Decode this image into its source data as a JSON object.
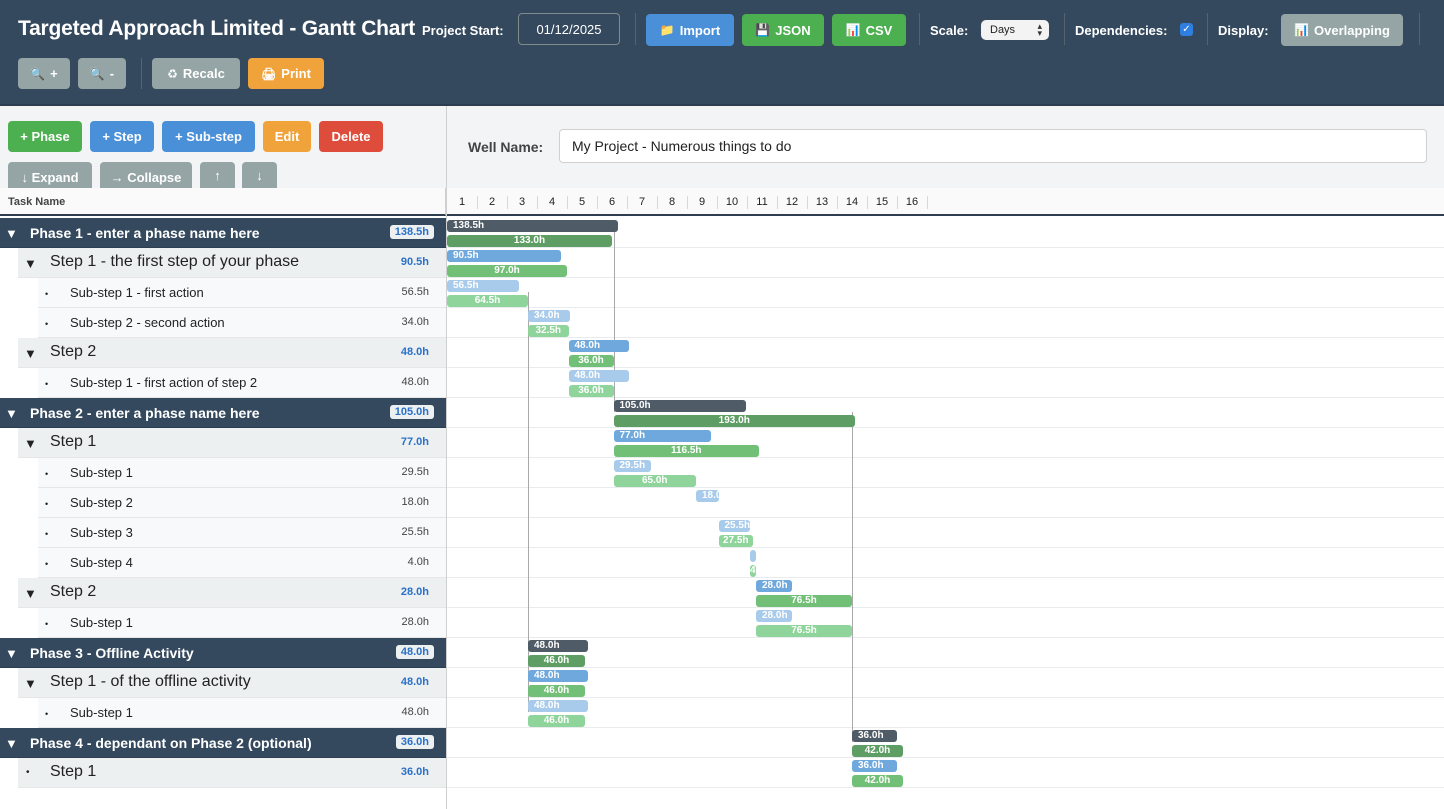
{
  "header": {
    "title": "Targeted Approach Limited - Gantt Chart",
    "project_start_label": "Project Start:",
    "project_start_value": "01/12/2025",
    "import_label": "Import",
    "json_label": "JSON",
    "csv_label": "CSV",
    "scale_label": "Scale:",
    "scale_value": "Days",
    "dependencies_label": "Dependencies:",
    "dependencies_checked": true,
    "display_label": "Display:",
    "display_value": "Overlapping",
    "zoom_in_label": "+",
    "zoom_out_label": "-",
    "recalc_label": "Recalc",
    "print_label": "Print"
  },
  "toolbar": {
    "add_phase": "+ Phase",
    "add_step": "+ Step",
    "add_substep": "+ Sub-step",
    "edit": "Edit",
    "delete": "Delete",
    "expand": "↓ Expand",
    "collapse": "→ Collapse",
    "move_up": "↑",
    "move_down": "↓"
  },
  "well": {
    "label": "Well Name:",
    "value": "My Project - Numerous things to do"
  },
  "task_header": "Task Name",
  "day_ticks": [
    "1",
    "2",
    "3",
    "4",
    "5",
    "6",
    "7",
    "8",
    "9",
    "10",
    "11",
    "12",
    "13",
    "14",
    "15",
    "16"
  ],
  "tasks": [
    {
      "level": "phase",
      "toggle": "▼",
      "name": "Phase 1 - enter a phase name here",
      "hours": "138.5h"
    },
    {
      "level": "step",
      "toggle": "▼",
      "name": "Step 1 - the first step of your phase",
      "hours": "90.5h"
    },
    {
      "level": "sub",
      "toggle": "•",
      "name": "Sub-step 1 - first action",
      "hours": "56.5h"
    },
    {
      "level": "sub",
      "toggle": "•",
      "name": "Sub-step 2 - second action",
      "hours": "34.0h"
    },
    {
      "level": "step",
      "toggle": "▼",
      "name": "Step 2",
      "hours": "48.0h"
    },
    {
      "level": "sub",
      "toggle": "•",
      "name": "Sub-step 1 - first action of step 2",
      "hours": "48.0h"
    },
    {
      "level": "phase",
      "toggle": "▼",
      "name": "Phase 2 - enter a phase name here",
      "hours": "105.0h"
    },
    {
      "level": "step",
      "toggle": "▼",
      "name": "Step 1",
      "hours": "77.0h"
    },
    {
      "level": "sub",
      "toggle": "•",
      "name": "Sub-step 1",
      "hours": "29.5h"
    },
    {
      "level": "sub",
      "toggle": "•",
      "name": "Sub-step 2",
      "hours": "18.0h"
    },
    {
      "level": "sub",
      "toggle": "•",
      "name": "Sub-step 3",
      "hours": "25.5h"
    },
    {
      "level": "sub",
      "toggle": "•",
      "name": "Sub-step 4",
      "hours": "4.0h"
    },
    {
      "level": "step",
      "toggle": "▼",
      "name": "Step 2",
      "hours": "28.0h"
    },
    {
      "level": "sub",
      "toggle": "•",
      "name": "Sub-step 1",
      "hours": "28.0h"
    },
    {
      "level": "phase",
      "toggle": "▼",
      "name": "Phase 3 - Offline Activity",
      "hours": "48.0h"
    },
    {
      "level": "step",
      "toggle": "▼",
      "name": "Step 1 - of the offline activity",
      "hours": "48.0h"
    },
    {
      "level": "sub",
      "toggle": "•",
      "name": "Sub-step 1",
      "hours": "48.0h"
    },
    {
      "level": "phase",
      "toggle": "▼",
      "name": "Phase 4 - dependant on Phase 2 (optional)",
      "hours": "36.0h"
    },
    {
      "level": "step",
      "toggle": "•",
      "name": "Step 1",
      "hours": "36.0h"
    }
  ],
  "bars": [
    {
      "row": 0,
      "planned": {
        "start": 1.0,
        "end": 6.7,
        "label": "138.5h"
      },
      "actual": {
        "start": 1.0,
        "end": 6.5,
        "label": "133.0h"
      }
    },
    {
      "row": 1,
      "planned": {
        "start": 1.0,
        "end": 4.8,
        "label": "90.5h"
      },
      "actual": {
        "start": 1.0,
        "end": 5.0,
        "label": "97.0h"
      }
    },
    {
      "row": 2,
      "planned": {
        "start": 1.0,
        "end": 3.4,
        "label": "56.5h"
      },
      "actual": {
        "start": 1.0,
        "end": 3.7,
        "label": "64.5h"
      }
    },
    {
      "row": 3,
      "planned": {
        "start": 3.7,
        "end": 5.1,
        "label": "34.0h"
      },
      "actual": {
        "start": 3.7,
        "end": 5.05,
        "label": "32.5h"
      }
    },
    {
      "row": 4,
      "planned": {
        "start": 5.05,
        "end": 7.05,
        "label": "48.0h"
      },
      "actual": {
        "start": 5.05,
        "end": 6.55,
        "label": "36.0h"
      }
    },
    {
      "row": 5,
      "planned": {
        "start": 5.05,
        "end": 7.05,
        "label": "48.0h"
      },
      "actual": {
        "start": 5.05,
        "end": 6.55,
        "label": "36.0h"
      }
    },
    {
      "row": 6,
      "planned": {
        "start": 6.55,
        "end": 10.95,
        "label": "105.0h"
      },
      "actual": {
        "start": 6.55,
        "end": 14.6,
        "label": "193.0h"
      }
    },
    {
      "row": 7,
      "planned": {
        "start": 6.55,
        "end": 9.8,
        "label": "77.0h"
      },
      "actual": {
        "start": 6.55,
        "end": 11.4,
        "label": "116.5h"
      }
    },
    {
      "row": 8,
      "planned": {
        "start": 6.55,
        "end": 7.8,
        "label": "29.5h"
      },
      "actual": {
        "start": 6.55,
        "end": 9.3,
        "label": "65.0h"
      }
    },
    {
      "row": 9,
      "planned": {
        "start": 9.3,
        "end": 10.05,
        "label": "18.0h"
      },
      "actual": null
    },
    {
      "row": 10,
      "planned": {
        "start": 10.05,
        "end": 11.1,
        "label": "25.5h"
      },
      "actual": {
        "start": 10.05,
        "end": 11.2,
        "label": "27.5h"
      }
    },
    {
      "row": 11,
      "planned": {
        "start": 11.1,
        "end": 11.3,
        "label": "4.0h"
      },
      "actual": {
        "start": 11.1,
        "end": 11.3,
        "label": "4.0h"
      }
    },
    {
      "row": 12,
      "planned": {
        "start": 11.3,
        "end": 12.5,
        "label": "28.0h"
      },
      "actual": {
        "start": 11.3,
        "end": 14.5,
        "label": "76.5h"
      }
    },
    {
      "row": 13,
      "planned": {
        "start": 11.3,
        "end": 12.5,
        "label": "28.0h"
      },
      "actual": {
        "start": 11.3,
        "end": 14.5,
        "label": "76.5h"
      }
    },
    {
      "row": 14,
      "planned": {
        "start": 3.7,
        "end": 5.7,
        "label": "48.0h"
      },
      "actual": {
        "start": 3.7,
        "end": 5.6,
        "label": "46.0h"
      }
    },
    {
      "row": 15,
      "planned": {
        "start": 3.7,
        "end": 5.7,
        "label": "48.0h"
      },
      "actual": {
        "start": 3.7,
        "end": 5.6,
        "label": "46.0h"
      }
    },
    {
      "row": 16,
      "planned": {
        "start": 3.7,
        "end": 5.7,
        "label": "48.0h"
      },
      "actual": {
        "start": 3.7,
        "end": 5.6,
        "label": "46.0h"
      }
    },
    {
      "row": 17,
      "planned": {
        "start": 14.5,
        "end": 16.0,
        "label": "36.0h"
      },
      "actual": {
        "start": 14.5,
        "end": 16.2,
        "label": "42.0h"
      }
    },
    {
      "row": 18,
      "planned": {
        "start": 14.5,
        "end": 16.0,
        "label": "36.0h"
      },
      "actual": {
        "start": 14.5,
        "end": 16.2,
        "label": "42.0h"
      }
    }
  ],
  "dependency_lines": [
    {
      "day": 3.7,
      "from_row": 2,
      "to_row": 16
    },
    {
      "day": 6.55,
      "from_row": 0,
      "to_row": 6
    },
    {
      "day": 14.5,
      "from_row": 6,
      "to_row": 17
    }
  ],
  "colors": {
    "header_bg": "#34495e",
    "phase_planned": "#4f5b66",
    "phase_actual": "#5e9e64",
    "step_planned": "#6fa8dc",
    "step_actual": "#72bf78",
    "sub_planned": "#a8cbeb",
    "sub_actual": "#8fd49a",
    "accent_blue": "#4a90d9",
    "accent_green": "#4caf50"
  }
}
